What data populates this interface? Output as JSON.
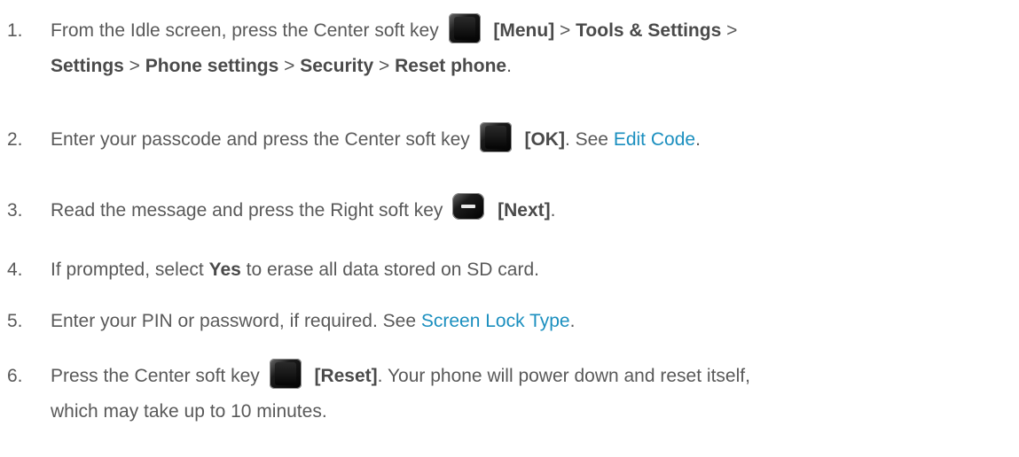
{
  "steps": [
    {
      "number": "1.",
      "parts": {
        "a": "From the Idle screen, press the Center soft key",
        "b": "[Menu]",
        "c": " > ",
        "d": "Tools & Settings",
        "e": " >",
        "f": "Settings",
        "g": " > ",
        "h": "Phone settings",
        "i": " > ",
        "j": "Security",
        "k": " > ",
        "l": "Reset phone",
        "m": "."
      },
      "icon": "center-soft-key-icon"
    },
    {
      "number": "2.",
      "parts": {
        "a": "Enter your passcode and press the Center soft key",
        "b": "[OK]",
        "c": ". See ",
        "d": "Edit Code",
        "e": "."
      },
      "icon": "center-soft-key-icon"
    },
    {
      "number": "3.",
      "parts": {
        "a": "Read the message and press the Right soft key",
        "b": "[Next]",
        "c": "."
      },
      "icon": "right-soft-key-icon"
    },
    {
      "number": "4.",
      "parts": {
        "a": "If prompted, select ",
        "b": "Yes",
        "c": " to erase all data stored on SD card."
      }
    },
    {
      "number": "5.",
      "parts": {
        "a": "Enter your PIN or password, if required. See ",
        "b": "Screen Lock Type",
        "c": "."
      }
    },
    {
      "number": "6.",
      "parts": {
        "a": "Press the Center soft key",
        "b": "[Reset]",
        "c": ". Your phone will power down and reset itself,",
        "d": "which may take up to 10 minutes."
      },
      "icon": "center-soft-key-icon"
    }
  ],
  "colors": {
    "body_text": "#595959",
    "bold_text": "#4a4a4a",
    "link": "#1b8fbf"
  }
}
